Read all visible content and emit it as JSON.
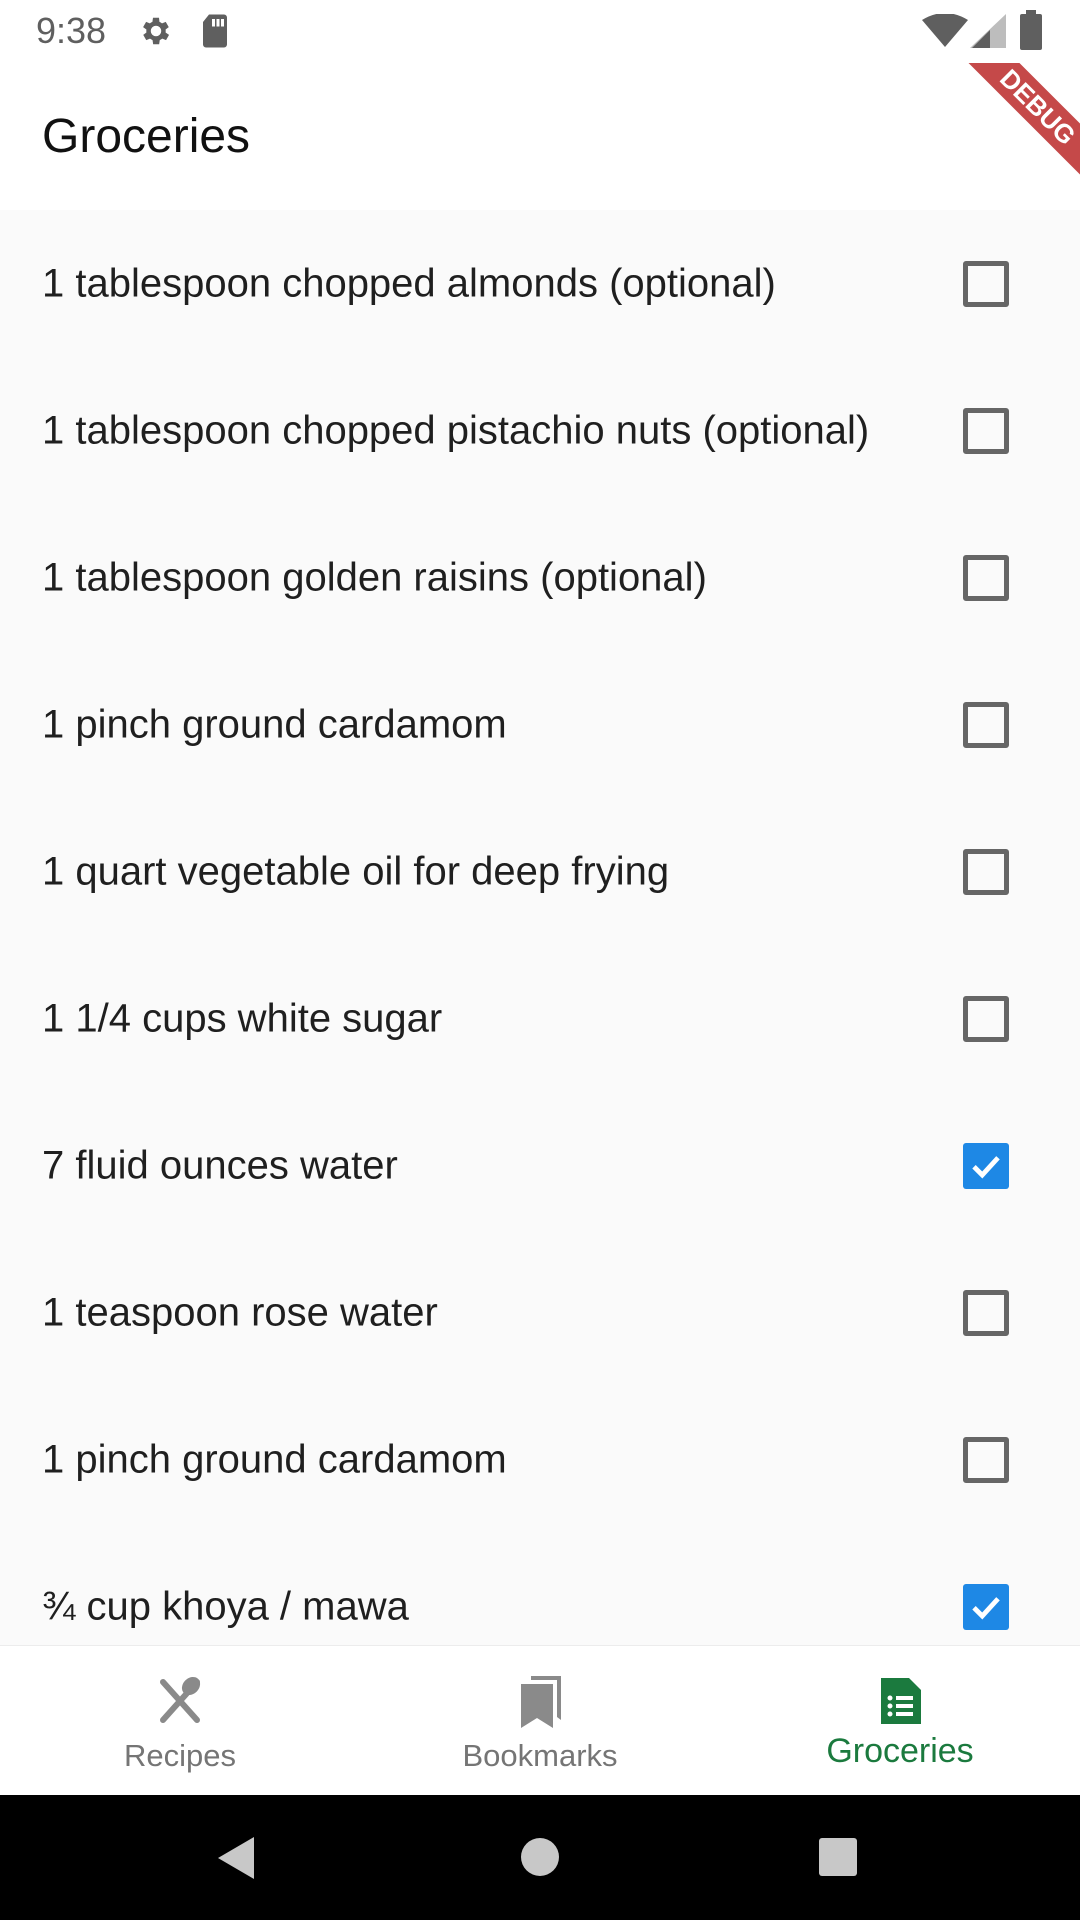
{
  "status_bar": {
    "time": "9:38",
    "icons": [
      "gear-icon",
      "sd-card-icon",
      "wifi-icon",
      "signal-icon",
      "battery-icon"
    ]
  },
  "app_bar": {
    "title": "Groceries",
    "debug_banner": "DEBUG"
  },
  "groceries": [
    {
      "text": "1 tablespoon chopped almonds (optional)",
      "checked": false
    },
    {
      "text": "1 tablespoon chopped pistachio nuts (optional)",
      "checked": false
    },
    {
      "text": "1 tablespoon golden raisins (optional)",
      "checked": false
    },
    {
      "text": "1 pinch ground cardamom",
      "checked": false
    },
    {
      "text": "1 quart vegetable oil for deep frying",
      "checked": false
    },
    {
      "text": "1 1/4 cups white sugar",
      "checked": false
    },
    {
      "text": "7 fluid ounces water",
      "checked": true
    },
    {
      "text": "1 teaspoon rose water",
      "checked": false
    },
    {
      "text": "1 pinch ground cardamom",
      "checked": false
    },
    {
      "text": "¾ cup khoya / mawa",
      "checked": true
    }
  ],
  "bottom_nav": {
    "items": [
      {
        "label": "Recipes",
        "icon": "fork-knife-icon",
        "active": false
      },
      {
        "label": "Bookmarks",
        "icon": "bookmarks-icon",
        "active": false
      },
      {
        "label": "Groceries",
        "icon": "list-icon",
        "active": true
      }
    ]
  },
  "colors": {
    "accent_checkbox": "#1e88e5",
    "active_nav": "#1b7a3e",
    "inactive_nav": "#757575"
  }
}
